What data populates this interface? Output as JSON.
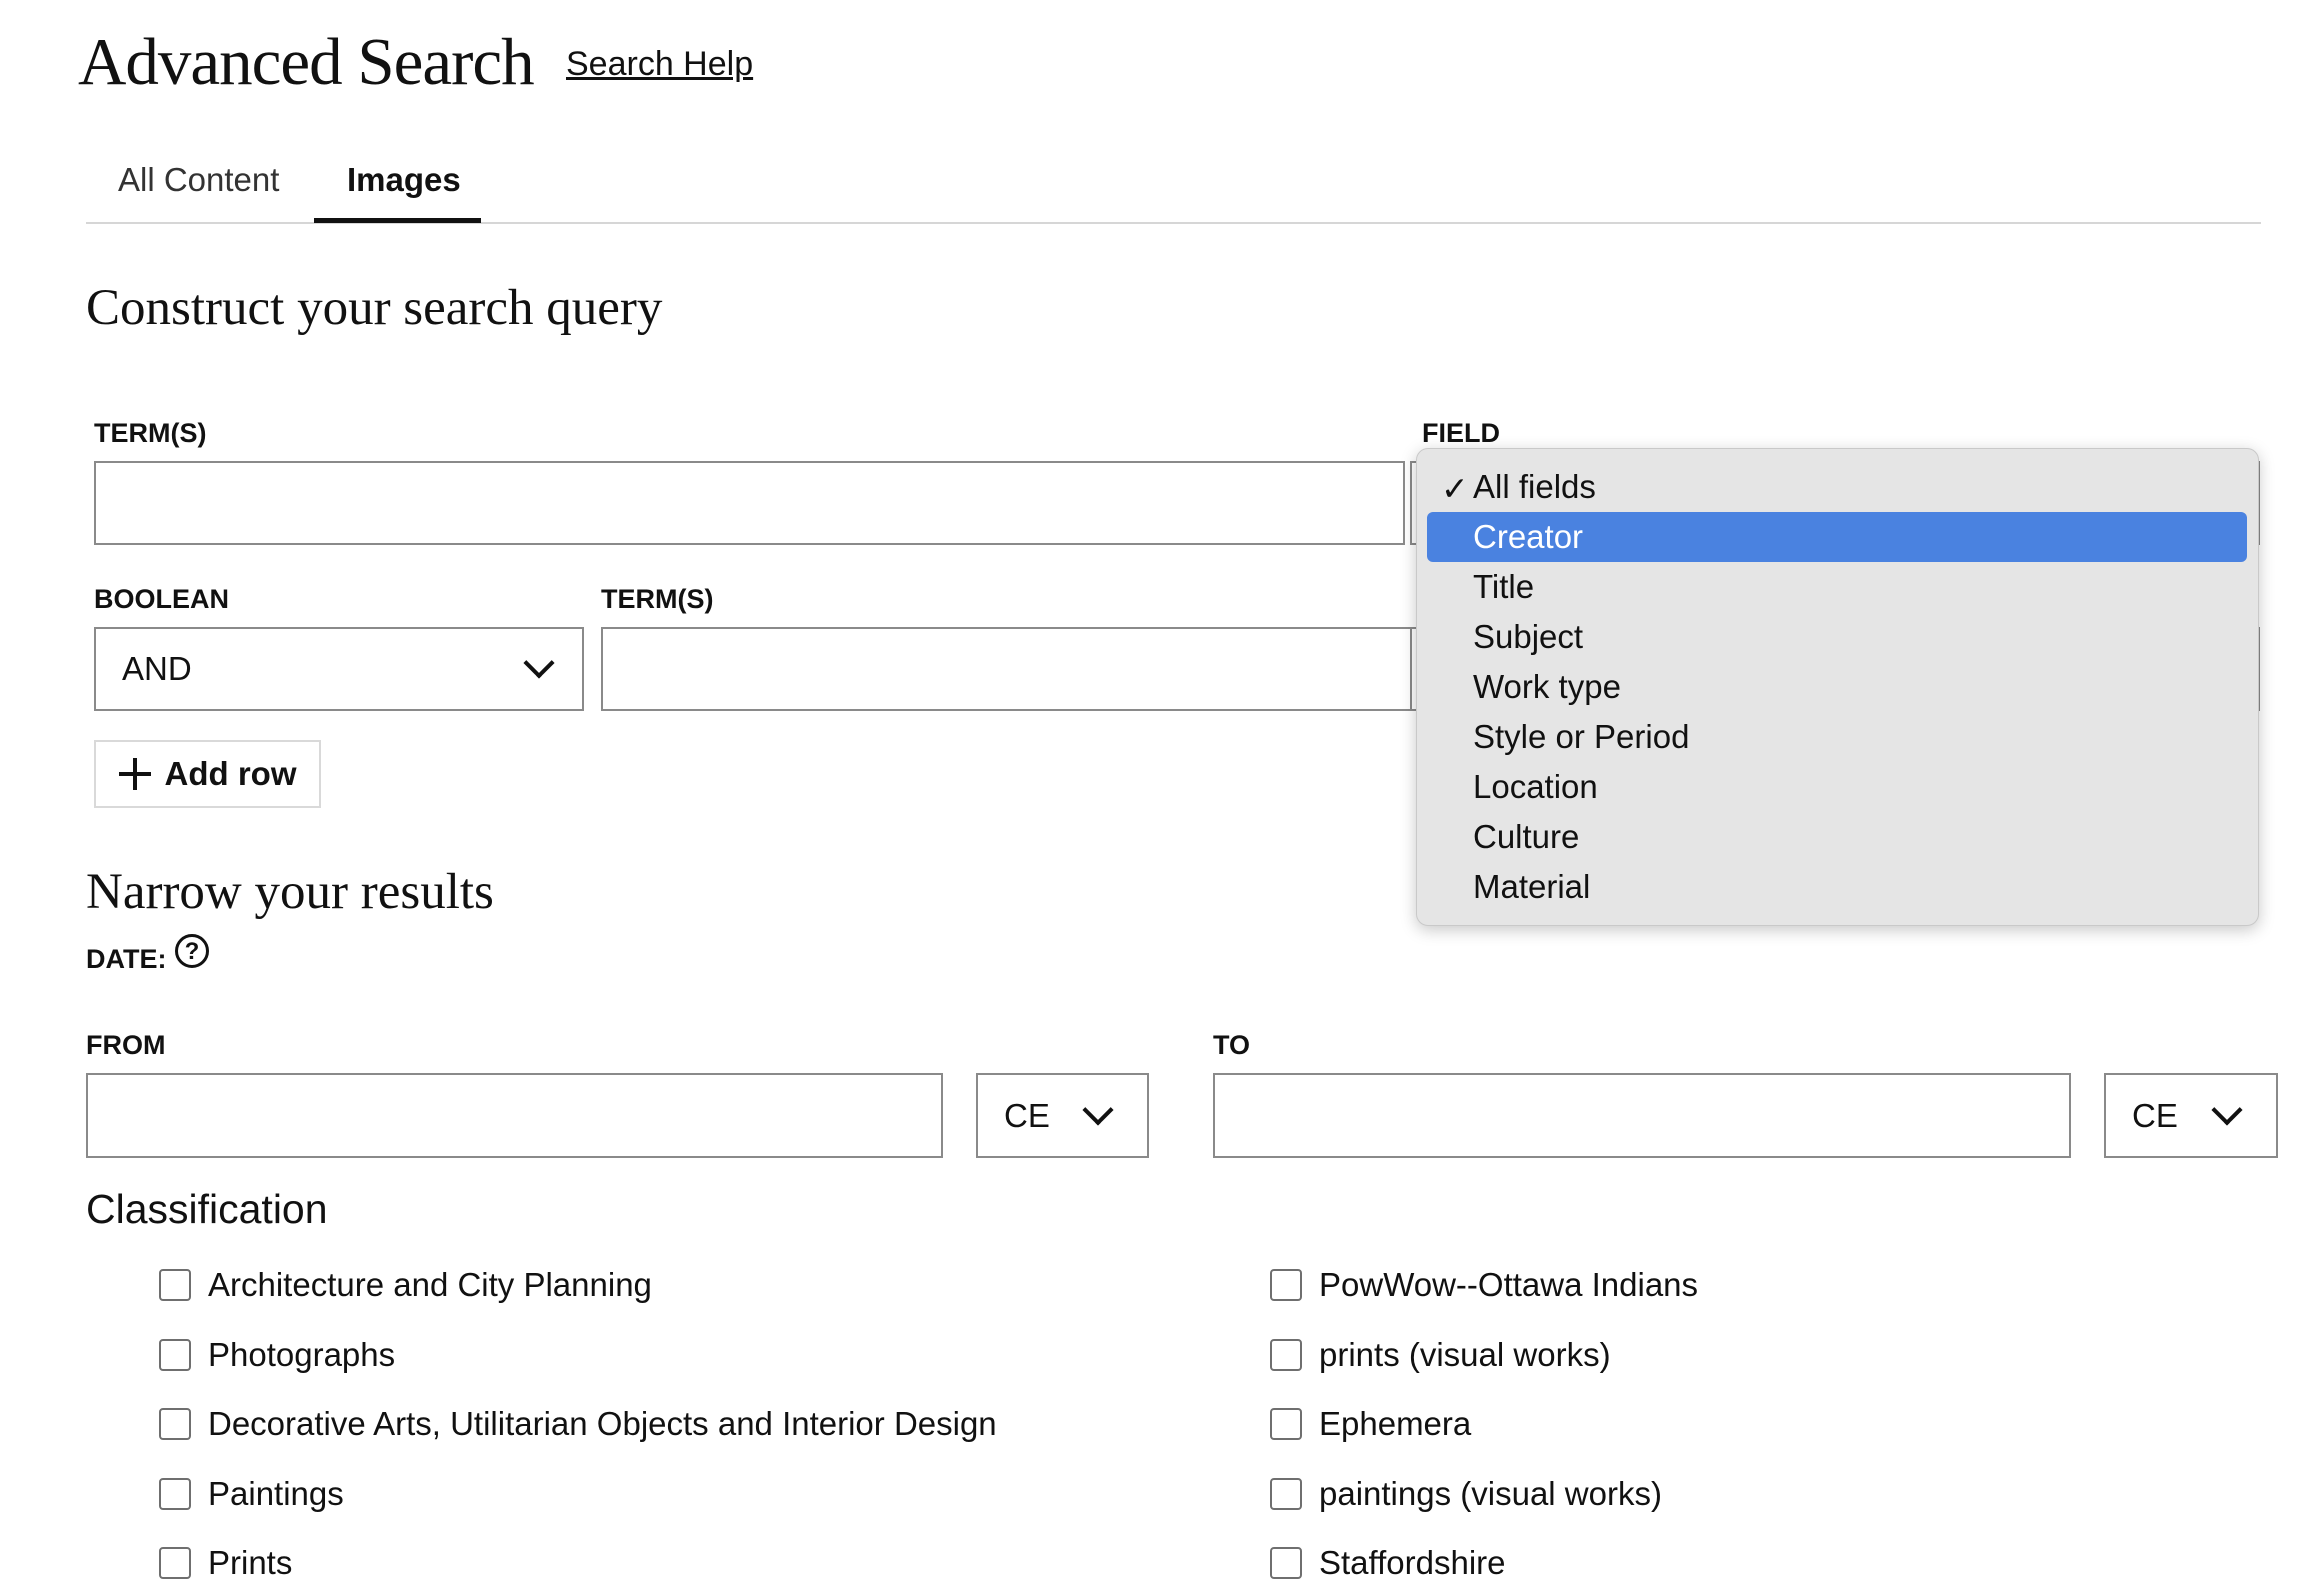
{
  "header": {
    "title": "Advanced Search",
    "help_link": "Search Help"
  },
  "tabs": [
    {
      "label": "All Content",
      "active": false
    },
    {
      "label": "Images",
      "active": true
    }
  ],
  "query": {
    "title": "Construct your search query",
    "terms_label": "TERM(S)",
    "field_label": "FIELD",
    "boolean_label": "BOOLEAN",
    "boolean_value": "AND",
    "terms2_label": "TERM(S)",
    "add_row": "Add row"
  },
  "field_dropdown": {
    "checked": "All fields",
    "highlighted": "Creator",
    "options": [
      "All fields",
      "Creator",
      "Title",
      "Subject",
      "Work type",
      "Style or Period",
      "Location",
      "Culture",
      "Material"
    ]
  },
  "narrow": {
    "title": "Narrow your results",
    "date_label": "DATE:",
    "help_glyph": "?",
    "from_label": "FROM",
    "from_era": "CE",
    "to_label": "TO",
    "to_era": "CE"
  },
  "classification": {
    "title": "Classification",
    "left": [
      "Architecture and City Planning",
      "Photographs",
      "Decorative Arts, Utilitarian Objects and Interior Design",
      "Paintings",
      "Prints"
    ],
    "right": [
      "PowWow--Ottawa Indians",
      "prints (visual works)",
      "Ephemera",
      "paintings (visual works)",
      "Staffordshire"
    ]
  },
  "colors": {
    "accent_highlight": "#4a82e0",
    "menu_bg": "#e5e5e5",
    "border": "#8a8a8a",
    "text": "#111111"
  }
}
